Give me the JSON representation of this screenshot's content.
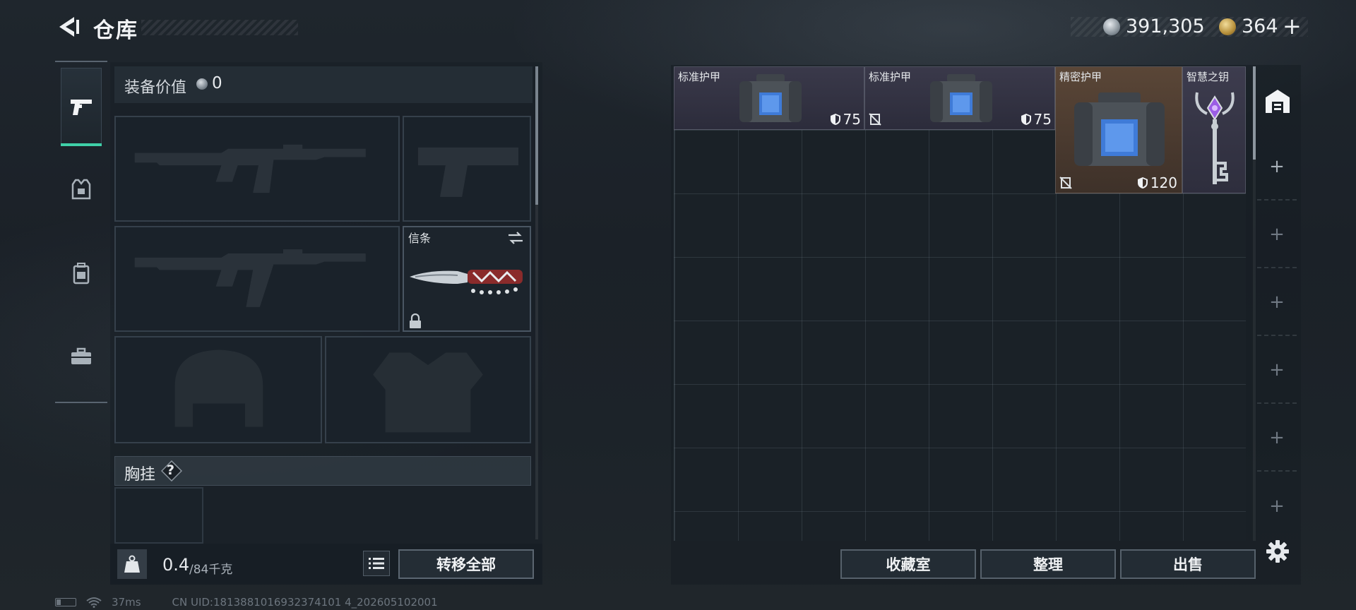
{
  "header": {
    "title": "仓库",
    "currency_silver": "391,305",
    "currency_gold": "364",
    "add_label": "+"
  },
  "loadout": {
    "value_label": "装备价值",
    "value": "0",
    "melee_label": "信条",
    "chest_label": "胸挂",
    "chest_help": "?",
    "weight_current": "0.4",
    "weight_max": "/84千克",
    "transfer_all_label": "转移全部"
  },
  "stash": {
    "items": [
      {
        "name": "标准护甲",
        "durability": "75",
        "rarity_color": "#35354a"
      },
      {
        "name": "标准护甲",
        "durability": "75",
        "rarity_color": "#35354a"
      },
      {
        "name": "精密护甲",
        "durability": "120",
        "rarity_color": "#4e3d31"
      },
      {
        "name": "智慧之钥",
        "rarity_color": "#36364a"
      }
    ],
    "add_tab_label": "+"
  },
  "actions": {
    "collection_label": "收藏室",
    "sort_label": "整理",
    "sell_label": "出售"
  },
  "status": {
    "ping": "37ms",
    "uid": "CN UID:1813881016932374101 4_202605102001"
  },
  "colors": {
    "accent": "#3fd0a8",
    "standard_rarity": "#35354a",
    "precise_rarity": "#4e3d31"
  }
}
